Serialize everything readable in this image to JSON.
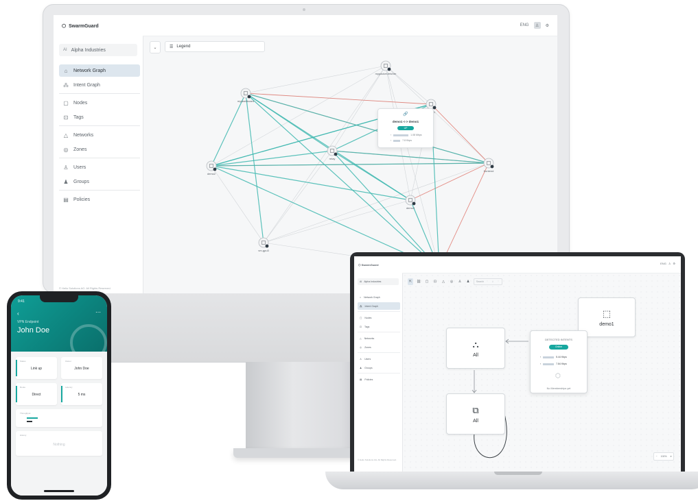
{
  "imac": {
    "app": {
      "logo": "SwarmGuard",
      "org_badge": "AI",
      "org_name": "Alpha Industries",
      "nav": [
        {
          "label": "Network Graph",
          "icon": "network-icon",
          "active": true
        },
        {
          "label": "Intent Graph",
          "icon": "intent-icon",
          "active": false
        },
        {
          "label": "Nodes",
          "icon": "nodes-icon",
          "active": false
        },
        {
          "label": "Tags",
          "icon": "tag-icon",
          "active": false
        },
        {
          "label": "Networks",
          "icon": "cloud-icon",
          "active": false
        },
        {
          "label": "Zones",
          "icon": "zone-icon",
          "active": false
        },
        {
          "label": "Users",
          "icon": "user-icon",
          "active": false
        },
        {
          "label": "Groups",
          "icon": "group-icon",
          "active": false
        },
        {
          "label": "Policies",
          "icon": "policy-icon",
          "active": false
        }
      ],
      "footer": "© Helio Solutions AG. All Rights Reserved.",
      "top_right_label": "ENG",
      "legend_label": "Legend"
    },
    "graph": {
      "nodes": [
        "mypacket-fetcher",
        "mydashboard",
        "relay",
        "demo1",
        "demo2",
        "frontend",
        "demo3",
        "vm-gpu3"
      ],
      "popup": {
        "title": "demo1 <-> demo1",
        "status": "UP",
        "rx": "1.08 Mbps",
        "tx": "7.8 Kbps"
      }
    }
  },
  "laptop": {
    "app": {
      "logo": "SwarmGuard",
      "org_badge": "AI",
      "org_name": "Alpha Industries",
      "nav": [
        {
          "label": "Network Graph",
          "active": false
        },
        {
          "label": "Intent Graph",
          "active": true
        },
        {
          "label": "Nodes",
          "active": false
        },
        {
          "label": "Tags",
          "active": false
        },
        {
          "label": "Networks",
          "active": false
        },
        {
          "label": "Zones",
          "active": false
        },
        {
          "label": "Users",
          "active": false
        },
        {
          "label": "Groups",
          "active": false
        },
        {
          "label": "Policies",
          "active": false
        }
      ],
      "footer": "© Helio Solutions AG. All Rights Reserved.",
      "top_right_label": "ENG",
      "search_placeholder": "Search"
    },
    "intent": {
      "card_top_left": "All",
      "card_bottom_left": "All",
      "card_right": "demo1",
      "popup": {
        "title": "DETECTED INTENTS",
        "status": "Online",
        "rx": "5.44 Kbps",
        "tx": "7.84 Kbps",
        "empty_text": "No Memberships yet"
      },
      "zoom_label": "100%"
    }
  },
  "phone": {
    "status_time": "9:41",
    "subtitle": "VPN Endpoint",
    "name": "John Doe",
    "cards": [
      {
        "label": "Status",
        "value": "Link up"
      },
      {
        "label": "Owner",
        "value": "John Doe"
      },
      {
        "label": "Route",
        "value": "Direct"
      },
      {
        "label": "Latency",
        "value": "5 ms"
      }
    ],
    "throughput_label": "Throughput",
    "history_label": "History",
    "history_value": "Nothing"
  }
}
